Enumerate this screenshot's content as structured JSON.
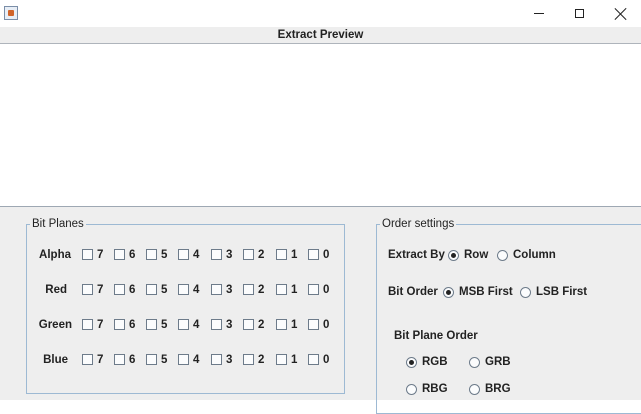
{
  "window": {
    "title_icon": "java-app-icon"
  },
  "preview": {
    "title": "Extract Preview"
  },
  "bit_planes": {
    "title": "Bit Planes",
    "rows": [
      {
        "label": "Alpha",
        "bits": [
          "7",
          "6",
          "5",
          "4",
          "3",
          "2",
          "1",
          "0"
        ]
      },
      {
        "label": "Red",
        "bits": [
          "7",
          "6",
          "5",
          "4",
          "3",
          "2",
          "1",
          "0"
        ]
      },
      {
        "label": "Green",
        "bits": [
          "7",
          "6",
          "5",
          "4",
          "3",
          "2",
          "1",
          "0"
        ]
      },
      {
        "label": "Blue",
        "bits": [
          "7",
          "6",
          "5",
          "4",
          "3",
          "2",
          "1",
          "0"
        ]
      }
    ]
  },
  "order_settings": {
    "title": "Order settings",
    "extract_by": {
      "label": "Extract By",
      "options": [
        "Row",
        "Column"
      ],
      "selected": "Row"
    },
    "bit_order": {
      "label": "Bit Order",
      "options": [
        "MSB First",
        "LSB First"
      ],
      "selected": "MSB First"
    },
    "bit_plane_order": {
      "label": "Bit Plane Order",
      "options": [
        "RGB",
        "GRB",
        "RBG",
        "BRG"
      ],
      "selected": "RGB"
    }
  }
}
